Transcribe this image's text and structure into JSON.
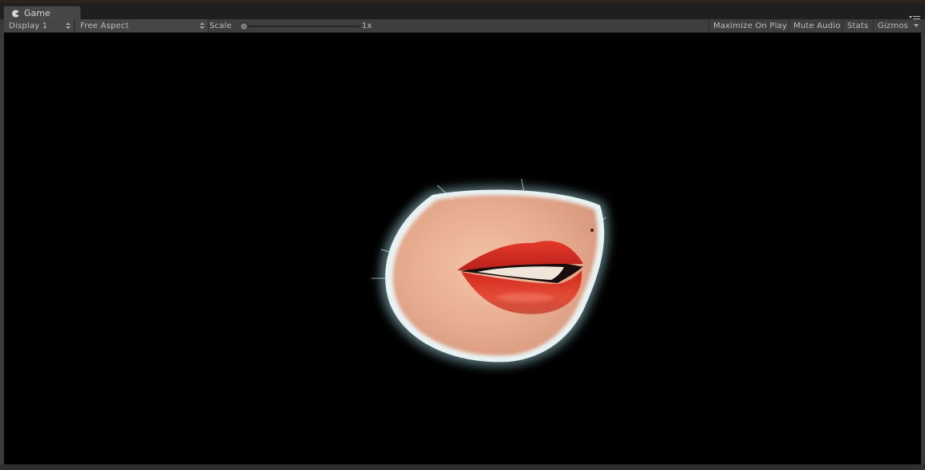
{
  "tab": {
    "title": "Game",
    "icon": "pacman-game-icon"
  },
  "toolbar": {
    "display": "Display 1",
    "aspect": "Free Aspect",
    "scale_label": "Scale",
    "scale_value": "1x",
    "scale_level": 0,
    "maximize_on_play": "Maximize On Play",
    "mute_audio": "Mute Audio",
    "stats": "Stats",
    "gizmos": "Gizmos"
  },
  "viewport": {
    "background": "#000000",
    "content": "rendered-lips-model"
  }
}
